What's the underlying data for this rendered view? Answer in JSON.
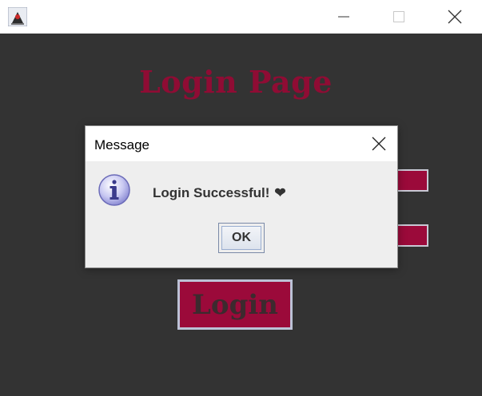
{
  "window": {
    "app_icon": "java-duke-icon",
    "controls": [
      "minimize-icon",
      "maximize-icon",
      "close-icon"
    ]
  },
  "page": {
    "title": "Login Page",
    "login_label": "Login"
  },
  "dialog": {
    "title": "Message",
    "message": "Login Successful!",
    "message_emoji": "❤",
    "ok_label": "OK",
    "icon": "info-icon"
  },
  "colors": {
    "background": "#333333",
    "accent": "#9b0a3a",
    "title_color": "#8f0c34"
  }
}
